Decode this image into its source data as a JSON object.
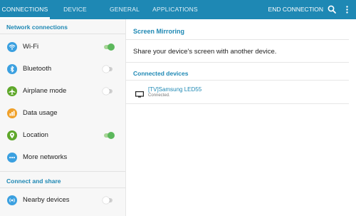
{
  "tabs": [
    {
      "label": "CONNECTIONS",
      "active": true
    },
    {
      "label": "DEVICE",
      "active": false
    },
    {
      "label": "GENERAL",
      "active": false
    },
    {
      "label": "APPLICATIONS",
      "active": false
    }
  ],
  "topbar": {
    "end_connection_label": "END CONNECTION",
    "search_icon": "search-icon",
    "more_icon": "more-vert-icon",
    "bg_color": "#1e88b4"
  },
  "sidebar": {
    "network_header": "Network connections",
    "share_header": "Connect and share",
    "items": [
      {
        "label": "Wi-Fi",
        "icon": "wifi-icon",
        "icon_color": "#3ba0e0",
        "toggle": "on"
      },
      {
        "label": "Bluetooth",
        "icon": "bluetooth-icon",
        "icon_color": "#3ba0e0",
        "toggle": "off"
      },
      {
        "label": "Airplane mode",
        "icon": "airplane-icon",
        "icon_color": "#5fa82b",
        "toggle": "off"
      },
      {
        "label": "Data usage",
        "icon": "data-usage-icon",
        "icon_color": "#f0a12a",
        "toggle": null
      },
      {
        "label": "Location",
        "icon": "location-icon",
        "icon_color": "#5fa82b",
        "toggle": "on"
      },
      {
        "label": "More networks",
        "icon": "more-networks-icon",
        "icon_color": "#3ba0e0",
        "toggle": null
      },
      {
        "label": "Nearby devices",
        "icon": "nearby-devices-icon",
        "icon_color": "#3ba0e0",
        "toggle": "off"
      }
    ]
  },
  "main": {
    "title": "Screen Mirroring",
    "description": "Share your device's screen with another device.",
    "connected_header": "Connected devices",
    "device": {
      "name": "[TV]Samsung LED55",
      "status": "Connected.",
      "icon": "tv-icon"
    }
  },
  "colors": {
    "accent": "#1e88b4",
    "toggle_on": "#5cb85c"
  }
}
